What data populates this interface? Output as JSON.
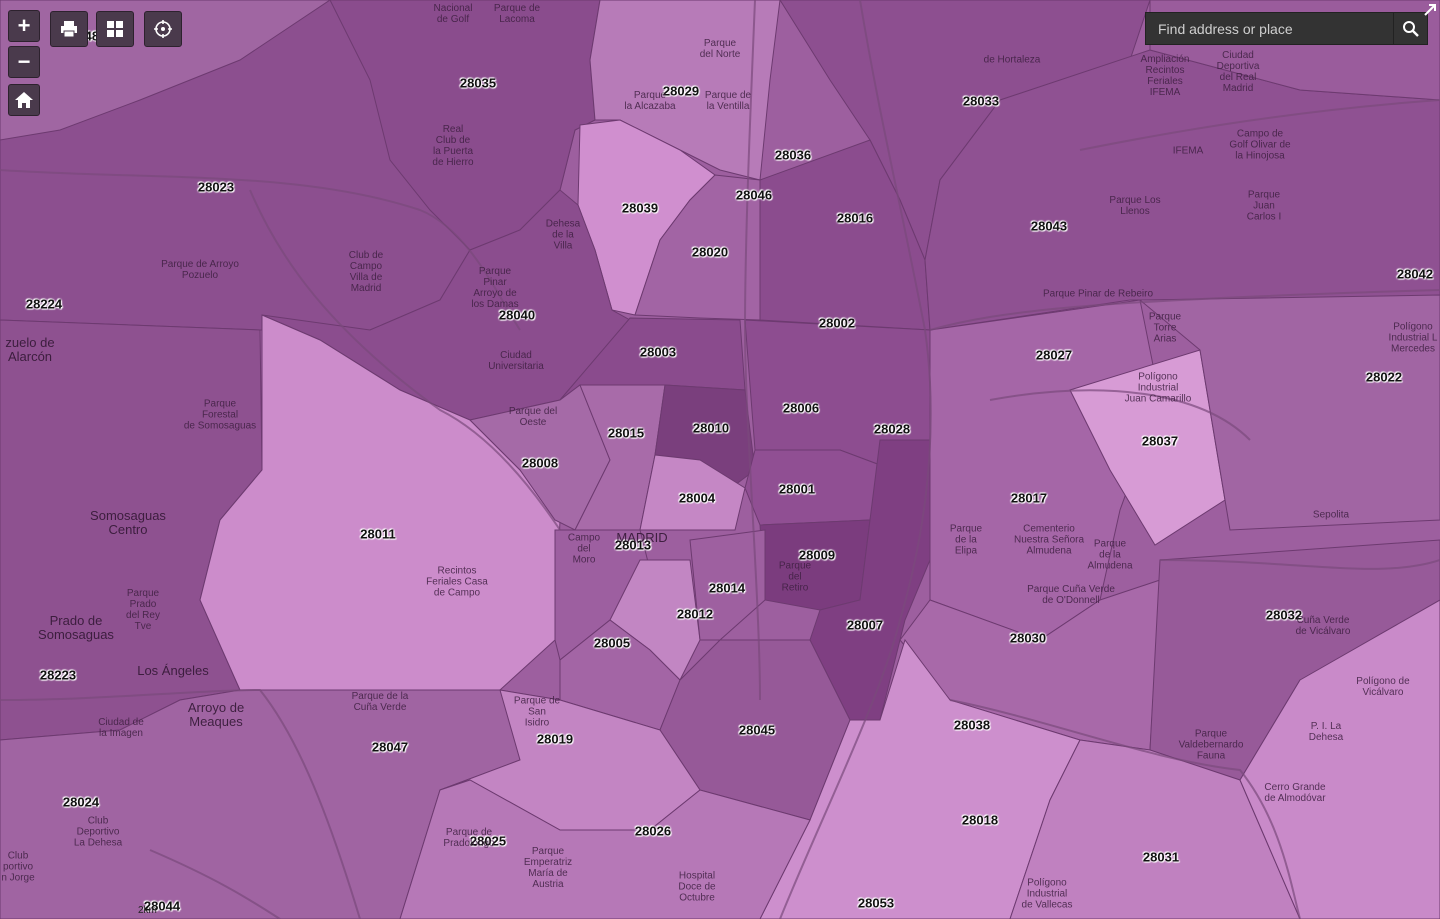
{
  "search": {
    "placeholder": "Find address or place"
  },
  "controls": {
    "zoom_in": "+",
    "zoom_out": "−",
    "home_icon": "home-icon",
    "print_icon": "print-icon",
    "basemap_icon": "grid-icon",
    "locate_icon": "locate-icon",
    "search_icon": "search-icon",
    "expand_icon": "expand-icon"
  },
  "scale_label": "2km",
  "colors": {
    "dark": "#8a4b8d",
    "medium": "#a466a6",
    "light": "#c282c3",
    "lightest": "#d89cd6"
  },
  "zip_labels": [
    "28048",
    "28035",
    "28029",
    "28033",
    "28023",
    "28036",
    "28046",
    "28039",
    "28016",
    "28043",
    "28020",
    "28224",
    "28040",
    "28042",
    "28002",
    "28003",
    "28027",
    "28022",
    "28006",
    "28015",
    "28010",
    "28028",
    "28037",
    "28008",
    "28001",
    "28004",
    "28017",
    "28011",
    "28013",
    "28009",
    "28014",
    "28012",
    "28007",
    "28032",
    "28005",
    "28030",
    "28223",
    "28045",
    "28038",
    "28047",
    "28019",
    "28024",
    "28018",
    "28025",
    "28026",
    "28031",
    "28044",
    "28053"
  ],
  "place_labels": [
    "Nacional\nde Golf",
    "Parque de\nLacoma",
    "Parque\ndel Norte",
    "Parque\nla Alcazaba",
    "Parque de\nla Ventilla",
    "Real\nClub de\nla Puerta\nde Hierro",
    "de Hortaleza",
    "Ampliación\nRecintos\nFeriales\nIFEMA",
    "Ciudad\nDeportiva\ndel Real\nMadrid",
    "IFEMA",
    "Campo de\nGolf Olivar de\nla Hinojosa",
    "Parque Los\nLlenos",
    "Parque\nJuan\nCarlos I",
    "Dehesa\nde la\nVilla",
    "Parque de Arroyo\nPozuelo",
    "Club de\nCampo\nVilla de\nMadrid",
    "Parque\nPinar\nArroyo de\nlos Damas",
    "Ciudad\nUniversitaria",
    "Parque Pinar de Rebeiro",
    "Parque\nTorre\nArias",
    "Polígono\nIndustrial\nJuan Camarillo",
    "Polígono\nIndustrial L\nMercedes",
    "Parque\nForestal\nde Somosaguas",
    "Parque del\nOeste",
    "Somosaguas\nCentro",
    "Campo\ndel\nMoro",
    "MADRID",
    "Recintos\nFeriales Casa\nde Campo",
    "Parque\ndel\nRetiro",
    "Cementerio\nNuestra Señora\nAlmudena",
    "Parque\nde la\nElipa",
    "Parque\nde la\nAlmudena",
    "Parque Cuña Verde\nde O'Donnell",
    "Sepolita",
    "Cuña Verde\nde Vicálvaro",
    "Prado de\nSomosaguas",
    "Los Ángeles",
    "Arroyo de\nMeaques",
    "Ciudad de\nla Imagen",
    "Parque de la\nCuña Verde",
    "Parque de\nSan\nIsidro",
    "Polígono de\nVicálvaro",
    "P. I. La\nDehesa",
    "Parque\nValdebernardo\nFauna",
    "Cerro Grande\nde Almodóvar",
    "Club\nDeportivo\nLa Dehesa",
    "Club\nportivo\nn Jorge",
    "Parque de\nPradolongo",
    "Parque\nEmperatriz\nMaría de\nAustria",
    "Hospital\nDoce de\nOctubre",
    "Polígono\nIndustrial\nde Vallecas",
    "zuelo de\nAlarcón",
    "Parque\nPrado\ndel Rey\nTve"
  ]
}
